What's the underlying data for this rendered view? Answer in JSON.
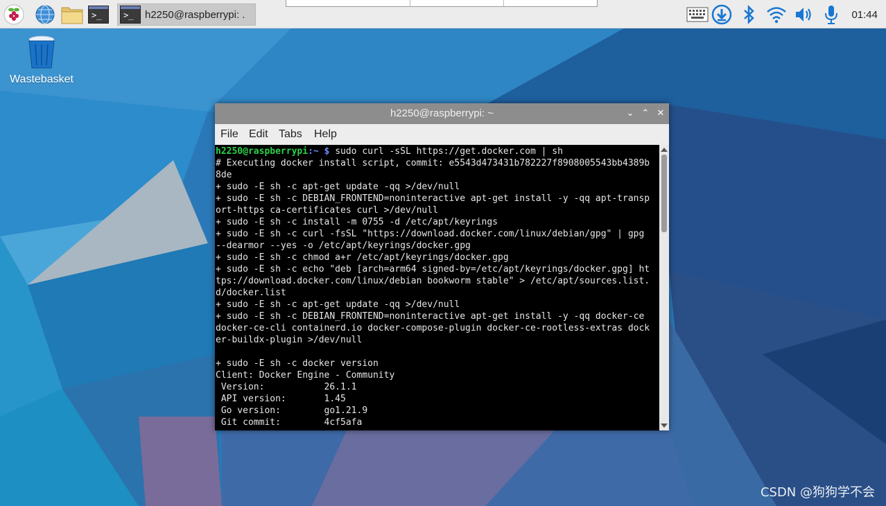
{
  "taskbar": {
    "launchers": [
      {
        "name": "raspberry-menu-icon"
      },
      {
        "name": "web-browser-icon"
      },
      {
        "name": "file-manager-icon"
      },
      {
        "name": "terminal-launcher-icon"
      }
    ],
    "task_button_label": "h2250@raspberrypi: .",
    "tray_icons": [
      "keyboard-icon",
      "download-update-icon",
      "bluetooth-icon",
      "wifi-icon",
      "volume-icon",
      "microphone-icon"
    ],
    "clock": "01:44",
    "accent": "#1976d2"
  },
  "desktop": {
    "wastebasket_label": "Wastebasket"
  },
  "window": {
    "title": "h2250@raspberrypi: ~",
    "menu": [
      "File",
      "Edit",
      "Tabs",
      "Help"
    ]
  },
  "terminal": {
    "prompt_user": "h2250@raspberrypi",
    "prompt_path": ":~ $",
    "command": " sudo curl -sSL https://get.docker.com | sh",
    "output_lines": [
      "# Executing docker install script, commit: e5543d473431b782227f8908005543bb4389b",
      "8de",
      "+ sudo -E sh -c apt-get update -qq >/dev/null",
      "+ sudo -E sh -c DEBIAN_FRONTEND=noninteractive apt-get install -y -qq apt-transp",
      "ort-https ca-certificates curl >/dev/null",
      "+ sudo -E sh -c install -m 0755 -d /etc/apt/keyrings",
      "+ sudo -E sh -c curl -fsSL \"https://download.docker.com/linux/debian/gpg\" | gpg",
      "--dearmor --yes -o /etc/apt/keyrings/docker.gpg",
      "+ sudo -E sh -c chmod a+r /etc/apt/keyrings/docker.gpg",
      "+ sudo -E sh -c echo \"deb [arch=arm64 signed-by=/etc/apt/keyrings/docker.gpg] ht",
      "tps://download.docker.com/linux/debian bookworm stable\" > /etc/apt/sources.list.",
      "d/docker.list",
      "+ sudo -E sh -c apt-get update -qq >/dev/null",
      "+ sudo -E sh -c DEBIAN_FRONTEND=noninteractive apt-get install -y -qq docker-ce",
      "docker-ce-cli containerd.io docker-compose-plugin docker-ce-rootless-extras dock",
      "er-buildx-plugin >/dev/null",
      "",
      "+ sudo -E sh -c docker version",
      "Client: Docker Engine - Community",
      " Version:           26.1.1",
      " API version:       1.45",
      " Go version:        go1.21.9",
      " Git commit:        4cf5afa"
    ]
  },
  "watermark": "CSDN @狗狗学不会"
}
